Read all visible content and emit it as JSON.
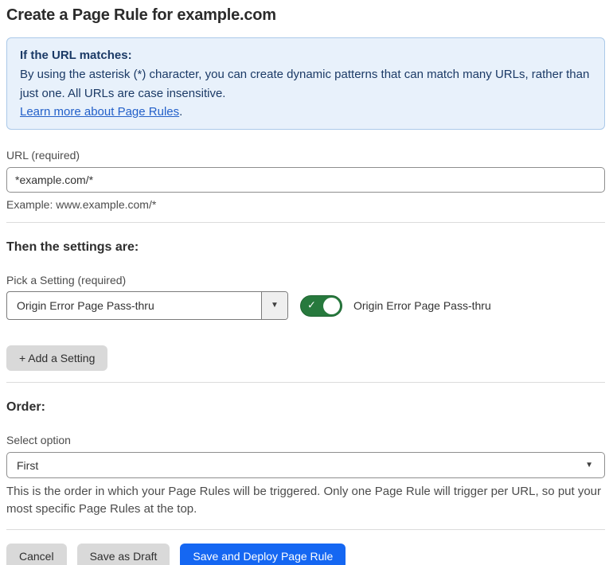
{
  "page": {
    "title": "Create a Page Rule for example.com"
  },
  "info_box": {
    "heading": "If the URL matches:",
    "body": "By using the asterisk (*) character, you can create dynamic patterns that can match many URLs, rather than just one. All URLs are case insensitive.",
    "link_label": "Learn more about Page Rules",
    "link_suffix": "."
  },
  "url_field": {
    "label": "URL (required)",
    "value": "*example.com/*",
    "helper": "Example: www.example.com/*"
  },
  "settings_section": {
    "heading": "Then the settings are:",
    "picker_label": "Pick a Setting (required)",
    "selected_setting": "Origin Error Page Pass-thru",
    "toggle": {
      "state": "on",
      "check_icon": "✓",
      "label": "Origin Error Page Pass-thru"
    },
    "add_setting_label": "+ Add a Setting"
  },
  "order_section": {
    "heading": "Order:",
    "select_label": "Select option",
    "selected_option": "First",
    "helper": "This is the order in which your Page Rules will be triggered. Only one Page Rule will trigger per URL, so put your most specific Page Rules at the top."
  },
  "icons": {
    "chevron_down": "▼"
  },
  "footer": {
    "cancel_label": "Cancel",
    "save_draft_label": "Save as Draft",
    "save_deploy_label": "Save and Deploy Page Rule"
  },
  "colors": {
    "info_box_bg": "#e8f1fb",
    "info_box_border": "#abc9e9",
    "info_text": "#1b3a66",
    "link_blue": "#2360c9",
    "toggle_green": "#27793d",
    "primary_button_blue": "#1567f2",
    "secondary_button_gray": "#d9d9d9"
  }
}
